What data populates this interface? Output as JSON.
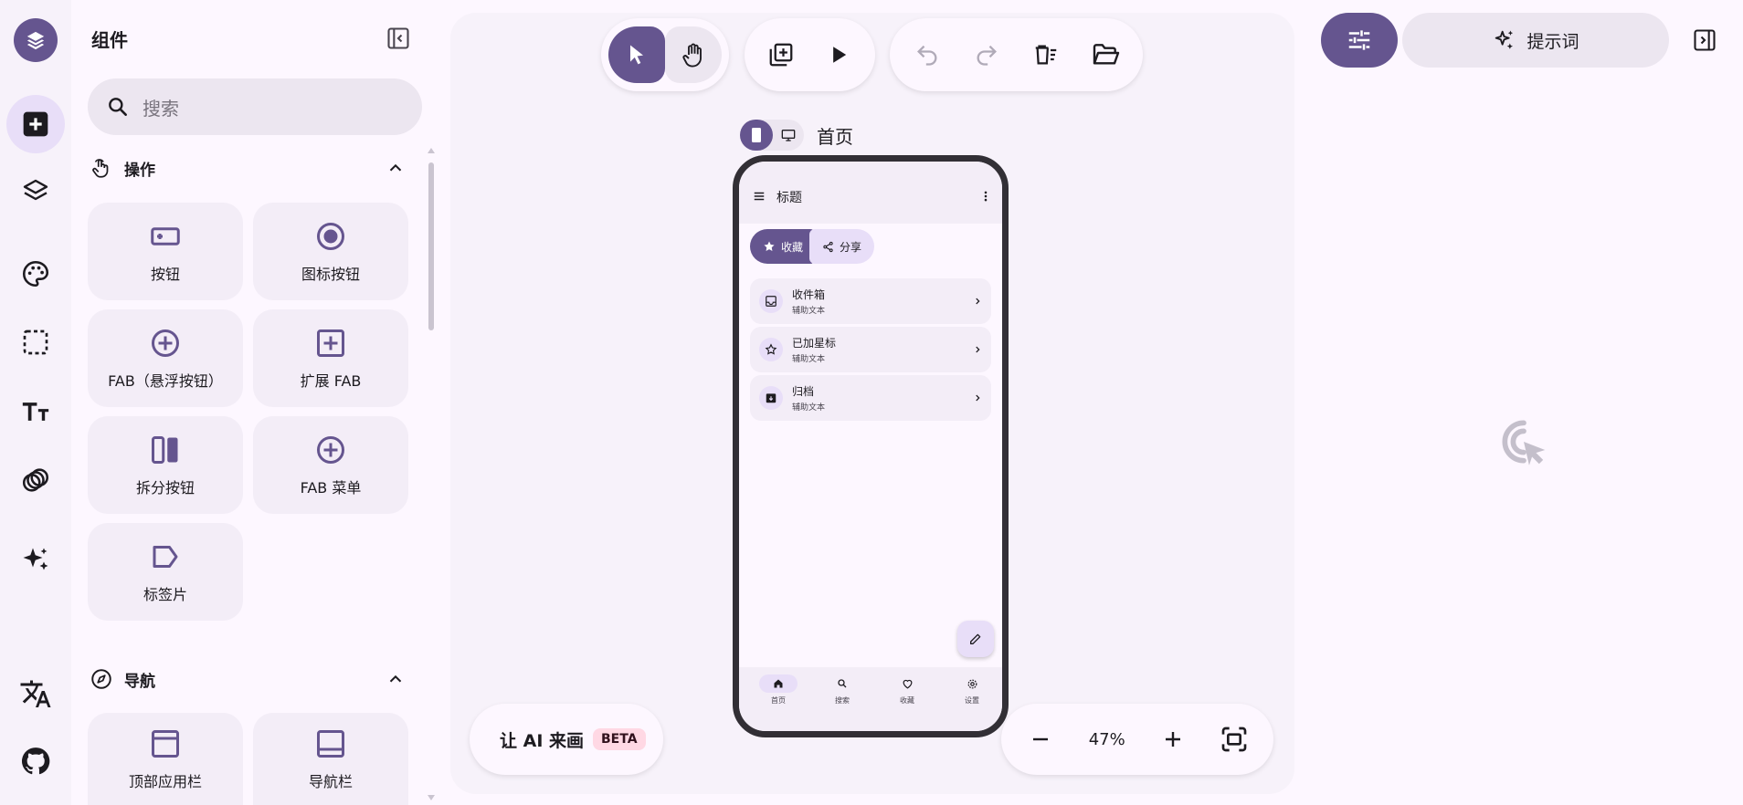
{
  "left_panel": {
    "title": "组件",
    "search_placeholder": "搜索",
    "sections": [
      {
        "label": "操作",
        "items": [
          {
            "label": "按钮",
            "icon": "button-icon"
          },
          {
            "label": "图标按钮",
            "icon": "radio-icon"
          },
          {
            "label": "FAB（悬浮按钮）",
            "icon": "add-circle-icon"
          },
          {
            "label": "扩展 FAB",
            "icon": "add-box-icon"
          },
          {
            "label": "拆分按钮",
            "icon": "split-icon"
          },
          {
            "label": "FAB 菜单",
            "icon": "add-circle-icon"
          },
          {
            "label": "标签片",
            "icon": "label-icon"
          }
        ]
      },
      {
        "label": "导航",
        "items": [
          {
            "label": "顶部应用栏",
            "icon": "top-bar-icon"
          },
          {
            "label": "导航栏",
            "icon": "bottom-bar-icon"
          }
        ]
      }
    ]
  },
  "canvas": {
    "page_name": "首页",
    "ai_button": "让 AI 来画",
    "ai_badge": "BETA",
    "zoom": "47%"
  },
  "phone": {
    "app_title": "标题",
    "chips": [
      "收藏",
      "分享"
    ],
    "list": [
      {
        "title": "收件箱",
        "subtitle": "辅助文本"
      },
      {
        "title": "已加星标",
        "subtitle": "辅助文本"
      },
      {
        "title": "归档",
        "subtitle": "辅助文本"
      }
    ],
    "nav": [
      "首页",
      "搜索",
      "收藏",
      "设置"
    ]
  },
  "right_panel": {
    "prompt_tab": "提示词"
  },
  "colors": {
    "primary": "#65558f",
    "secondary_container": "#e8def8",
    "surface": "#fdf7ff",
    "beta_badge": "#ffd8e4"
  }
}
